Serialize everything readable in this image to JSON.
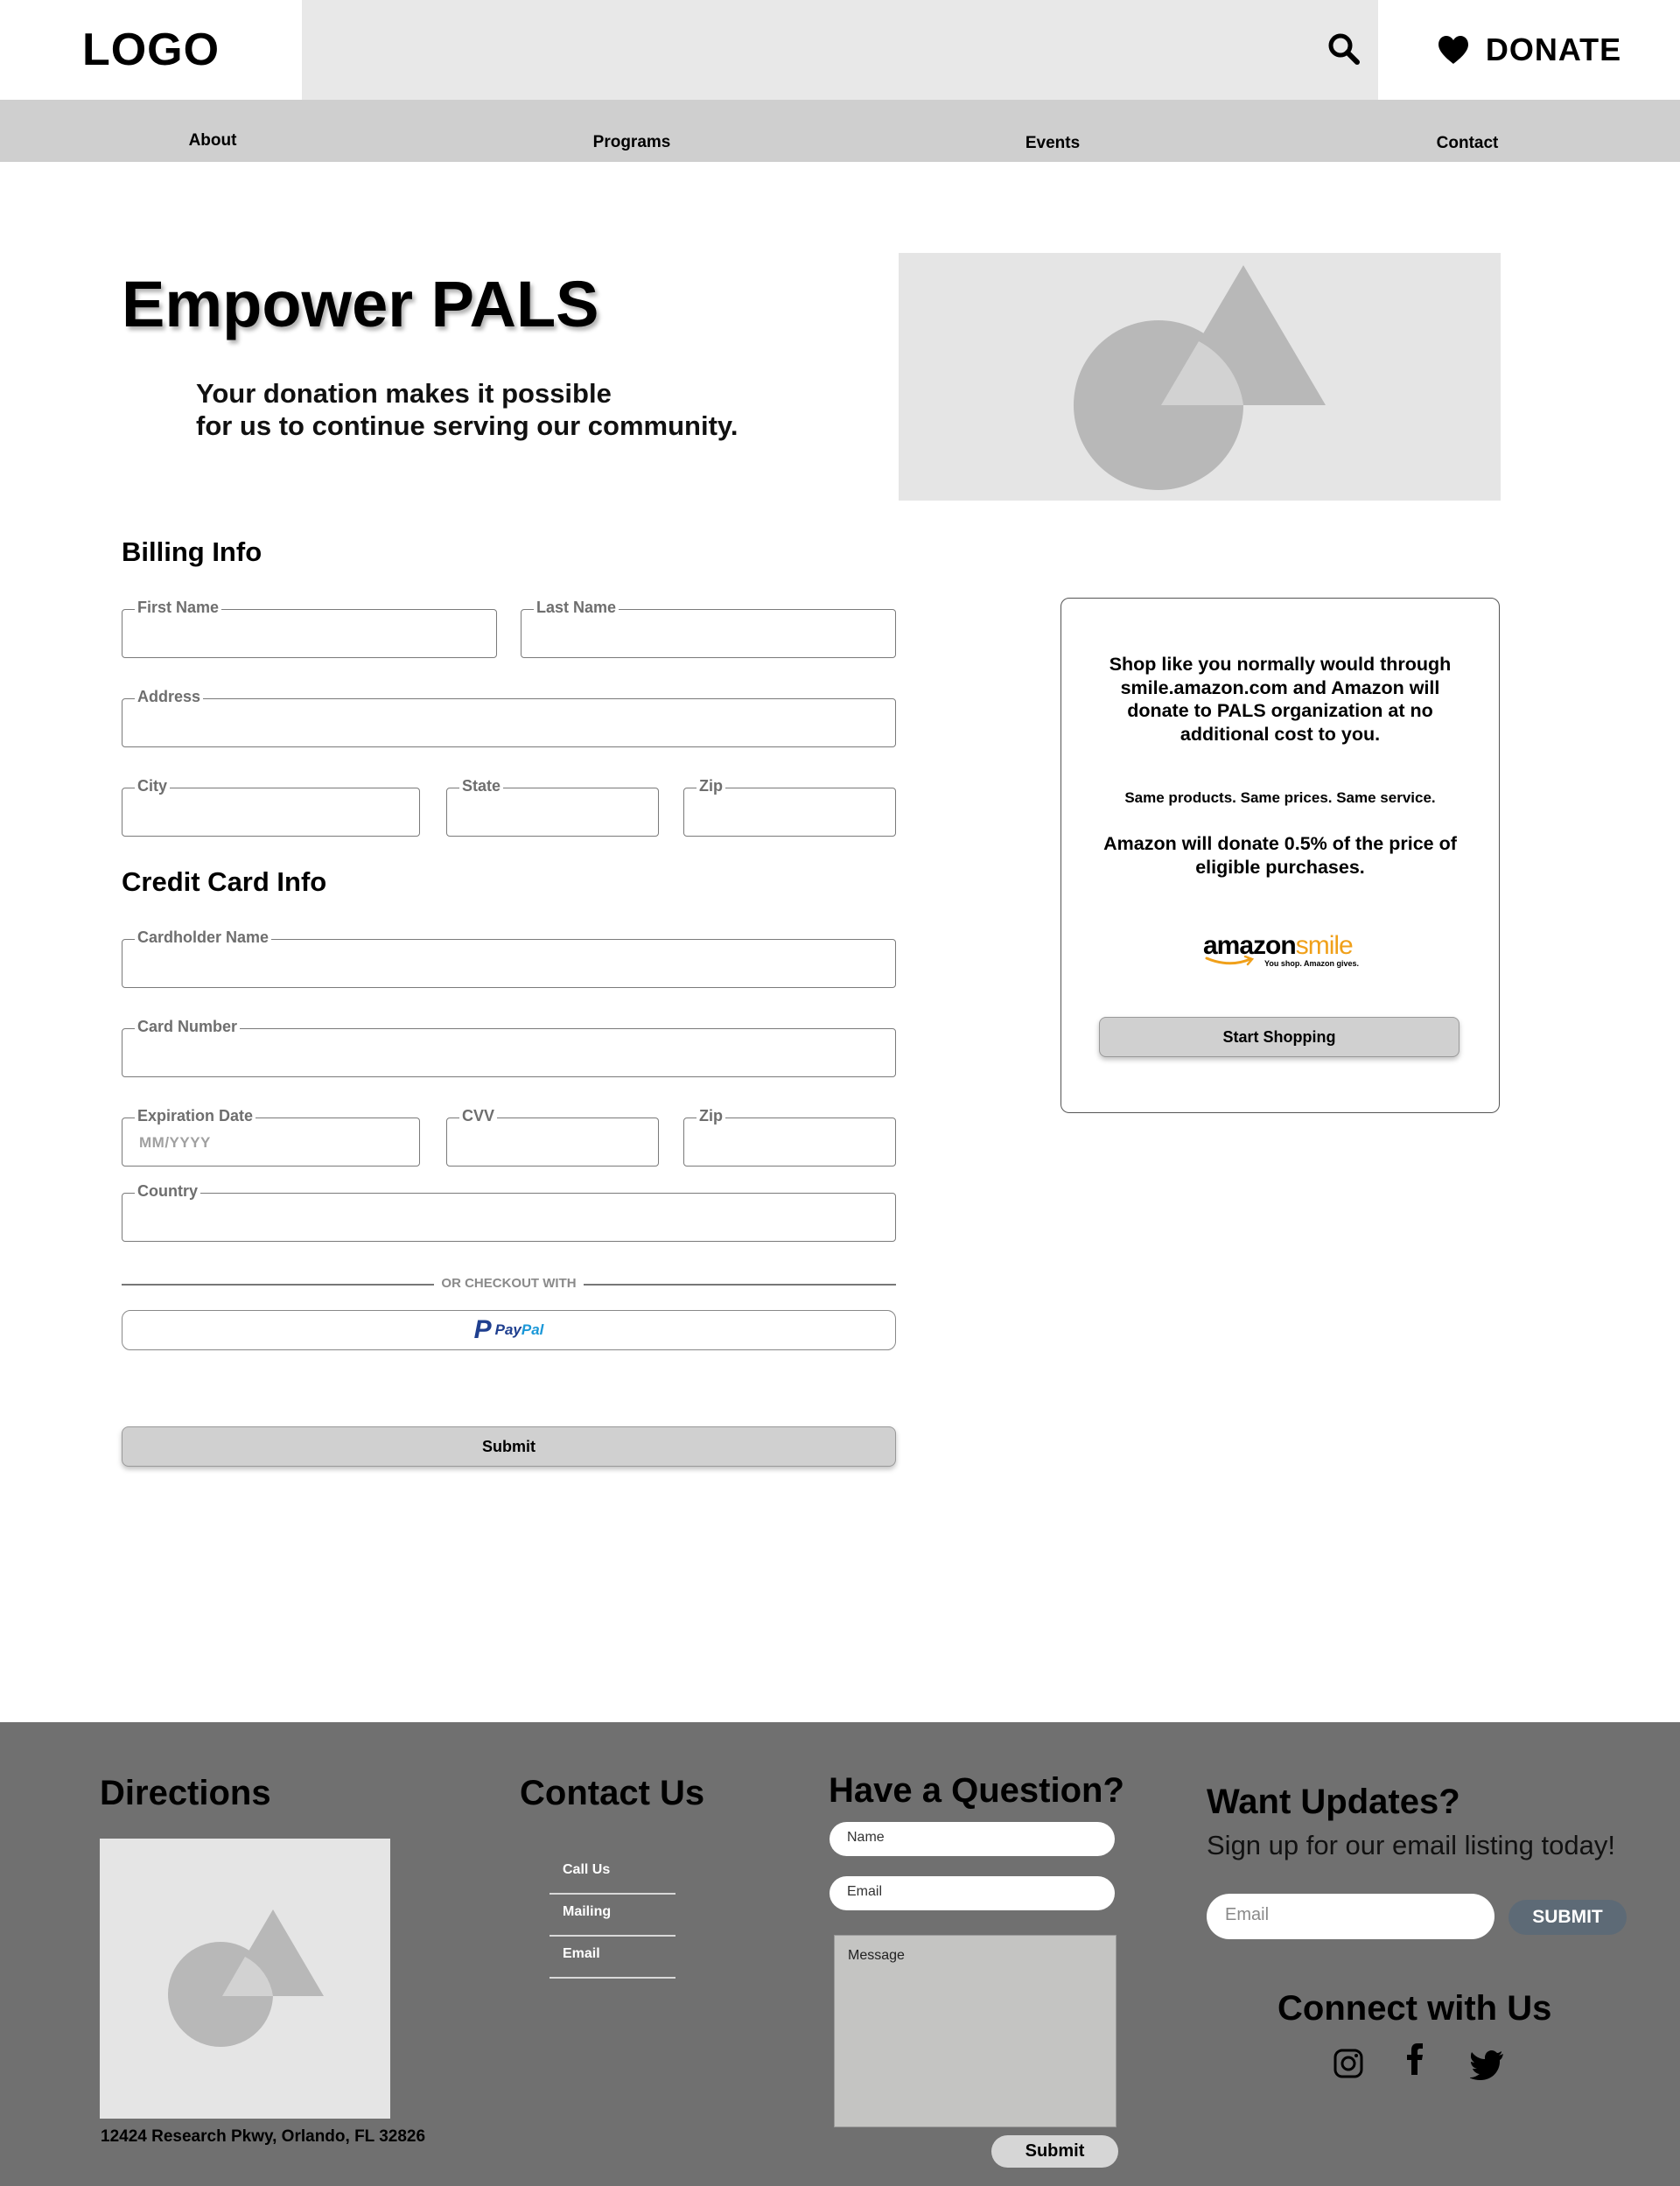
{
  "header": {
    "logo": "LOGO",
    "search_icon": "search-icon",
    "donate_label": "DONATE",
    "donate_icon": "heart-icon"
  },
  "nav": {
    "items": [
      "About",
      "Programs",
      "Events",
      "Contact"
    ]
  },
  "hero": {
    "title": "Empower PALS",
    "subtitle_line1": "Your donation makes it possible",
    "subtitle_line2": "for us to continue serving our community.",
    "image_icon": "image-placeholder-icon"
  },
  "billing": {
    "title": "Billing Info",
    "first_name_label": "First Name",
    "last_name_label": "Last Name",
    "address_label": "Address",
    "city_label": "City",
    "state_label": "State",
    "zip_label": "Zip"
  },
  "credit_card": {
    "title": "Credit Card Info",
    "cardholder_label": "Cardholder Name",
    "card_number_label": "Card Number",
    "expiration_label": "Expiration Date",
    "expiration_placeholder": "MM/YYYY",
    "cvv_label": "CVV",
    "zip_label": "Zip",
    "country_label": "Country"
  },
  "checkout": {
    "divider_text": "OR CHECKOUT WITH",
    "paypal_pay": "Pay",
    "paypal_pal": "Pal",
    "submit_label": "Submit"
  },
  "amazon": {
    "paragraph1": "Shop like you normally would through smile.amazon.com and Amazon will donate to PALS organization at no additional cost to you.",
    "paragraph2": "Same products. Same prices. Same service.",
    "paragraph3": "Amazon will donate 0.5% of the price of eligible purchases.",
    "logo_amazon": "amazon",
    "logo_smile": "smile",
    "logo_tagline": "You shop. Amazon gives.",
    "button_label": "Start Shopping",
    "brand_color": "#f0a01a"
  },
  "footer": {
    "directions_title": "Directions",
    "address": "12424 Research Pkwy, Orlando, FL 32826",
    "contact_title": "Contact Us",
    "contact_links": [
      "Call Us",
      "Mailing",
      "Email"
    ],
    "question_title": "Have a Question?",
    "name_placeholder": "Name",
    "email_placeholder": "Email",
    "message_placeholder": "Message",
    "question_submit": "Submit",
    "updates_title": "Want Updates?",
    "updates_subtitle": "Sign up for our email listing today!",
    "updates_email_placeholder": "Email",
    "updates_submit": "SUBMIT",
    "connect_title": "Connect with Us",
    "social_icons": [
      "instagram-icon",
      "facebook-icon",
      "twitter-icon"
    ],
    "background_color": "#707070"
  }
}
